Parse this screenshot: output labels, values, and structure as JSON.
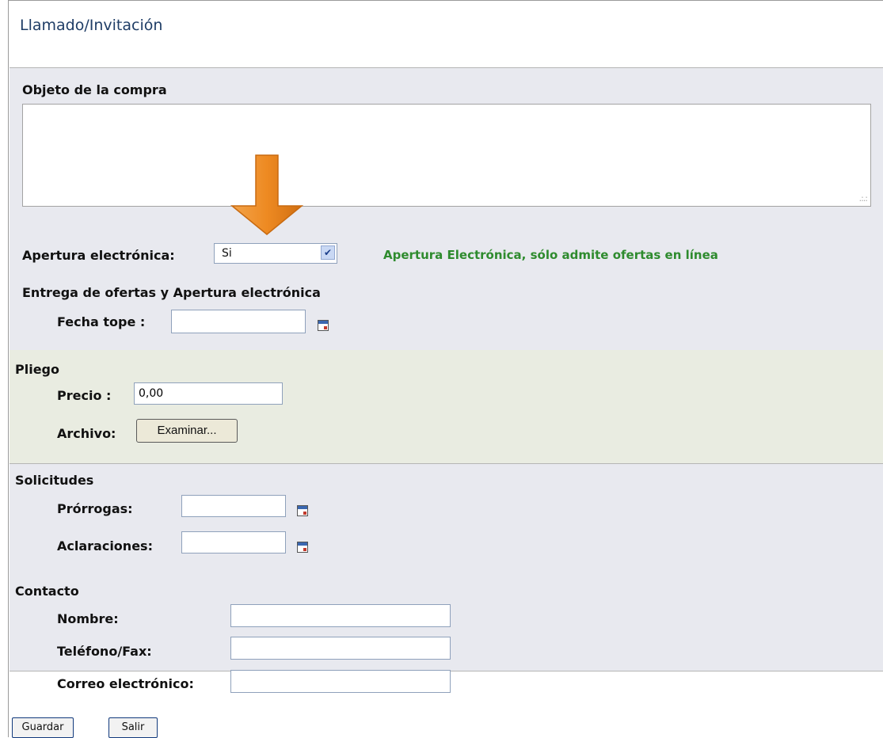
{
  "page": {
    "title": "Llamado/Invitación"
  },
  "objeto": {
    "label": "Objeto de la compra",
    "value": ""
  },
  "apertura": {
    "label": "Apertura electrónica:",
    "selected": "Si",
    "note": "Apertura Electrónica, sólo admite ofertas en línea",
    "note_color": "#2e8b2e"
  },
  "entrega": {
    "heading": "Entrega de ofertas y Apertura electrónica",
    "fecha_label": "Fecha tope :",
    "fecha_value": ""
  },
  "pliego": {
    "heading": "Pliego",
    "precio_label": "Precio :",
    "precio_value": "0,00",
    "archivo_label": "Archivo:",
    "examinar_label": "Examinar..."
  },
  "solicitudes": {
    "heading": "Solicitudes",
    "prorrogas_label": "Prórrogas:",
    "prorrogas_value": "",
    "aclaraciones_label": "Aclaraciones:",
    "aclaraciones_value": ""
  },
  "contacto": {
    "heading": "Contacto",
    "nombre_label": "Nombre:",
    "nombre_value": "",
    "telefono_label": "Teléfono/Fax:",
    "telefono_value": "",
    "correo_label": "Correo electrónico:",
    "correo_value": ""
  },
  "footer": {
    "guardar_label": "Guardar",
    "salir_label": "Salir"
  },
  "icons": {
    "calendar": "calendar-icon",
    "dropdown": "chevron-down-icon",
    "arrow": "arrow-down-icon"
  },
  "colors": {
    "title": "#1f3d66",
    "arrow": "#ee8a22"
  }
}
